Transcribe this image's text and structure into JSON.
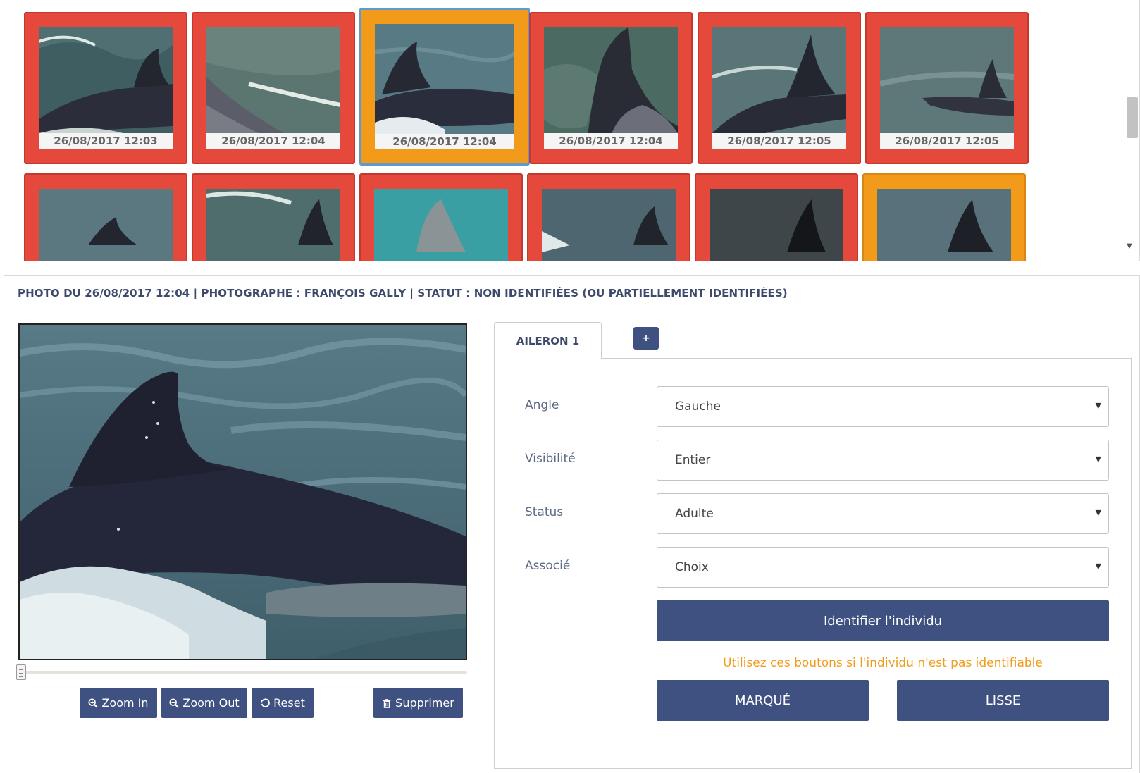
{
  "gallery": {
    "row1": [
      {
        "caption": "26/08/2017 12:03",
        "status": "red"
      },
      {
        "caption": "26/08/2017 12:04",
        "status": "red"
      },
      {
        "caption": "26/08/2017 12:04",
        "status": "orange",
        "selected": true
      },
      {
        "caption": "26/08/2017 12:04",
        "status": "red"
      },
      {
        "caption": "26/08/2017 12:05",
        "status": "red"
      },
      {
        "caption": "26/08/2017 12:05",
        "status": "red"
      }
    ],
    "row2": [
      {
        "status": "red"
      },
      {
        "status": "red"
      },
      {
        "status": "red"
      },
      {
        "status": "red"
      },
      {
        "status": "red"
      },
      {
        "status": "orange"
      }
    ]
  },
  "photo_info": "PHOTO DU 26/08/2017 12:04 | PHOTOGRAPHE : FRANÇOIS GALLY | STATUT : NON IDENTIFIÉES (OU PARTIELLEMENT IDENTIFIÉES)",
  "viewer": {
    "zoom_in": "Zoom In",
    "zoom_out": "Zoom Out",
    "reset": "Reset",
    "delete": "Supprimer"
  },
  "tabs": {
    "active": "AILERON 1",
    "add": "+"
  },
  "form": {
    "angle": {
      "label": "Angle",
      "value": "Gauche"
    },
    "visibility": {
      "label": "Visibilité",
      "value": "Entier"
    },
    "status": {
      "label": "Status",
      "value": "Adulte"
    },
    "associate": {
      "label": "Associé",
      "value": "Choix"
    },
    "identify": "Identifier l'individu",
    "hint": "Utilisez ces boutons si l'individu n'est pas identifiable",
    "marked": "MARQUÉ",
    "smooth": "LISSE"
  },
  "colors": {
    "red_frame": "#e5493b",
    "orange_frame": "#f29b1a",
    "primary": "#3f5180",
    "hint": "#f29b1a"
  }
}
